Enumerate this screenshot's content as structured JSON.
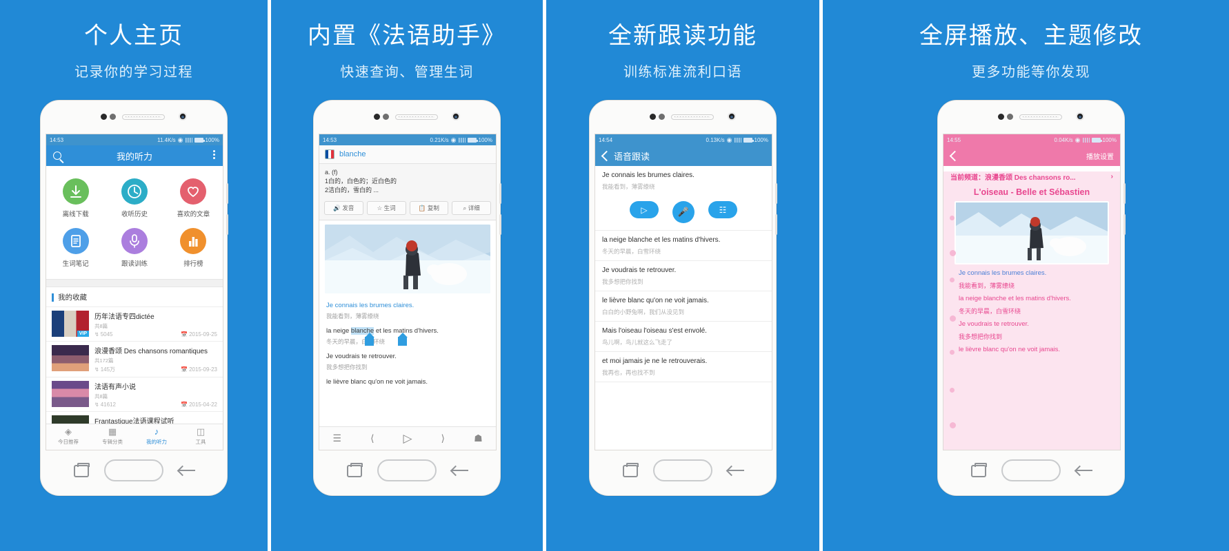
{
  "panels": [
    {
      "headline": "个人主页",
      "subhead": "记录你的学习过程",
      "status": {
        "time": "14:53",
        "net": "11.4K/s",
        "battery": "100%"
      },
      "appbar": {
        "title": "我的听力",
        "search_icon": "search-icon",
        "more_icon": "more-vertical-icon"
      },
      "grid": [
        {
          "label": "离线下载",
          "icon": "download-icon",
          "color": "#69bf5c"
        },
        {
          "label": "收听历史",
          "icon": "clock-icon",
          "color": "#2cadc7"
        },
        {
          "label": "喜欢的文章",
          "icon": "heart-icon",
          "color": "#e4606e"
        },
        {
          "label": "生词笔记",
          "icon": "notebook-icon",
          "color": "#4e9fe8"
        },
        {
          "label": "跟读训练",
          "icon": "microphone-icon",
          "color": "#ab7ede"
        },
        {
          "label": "排行榜",
          "icon": "bar-chart-icon",
          "color": "#f0902d"
        }
      ],
      "section_title": "我的收藏",
      "favorites": [
        {
          "title": "历年法语专四dictée",
          "count": "共8篇",
          "plays": "5045",
          "date": "2015-09-25",
          "badge": "VIP"
        },
        {
          "title": "浪漫香颂 Des chansons romantiques",
          "count": "共172篇",
          "plays": "145万",
          "date": "2015-09-23",
          "badge": ""
        },
        {
          "title": "法语有声小说",
          "count": "共8篇",
          "plays": "41612",
          "date": "2015-04-22",
          "badge": ""
        },
        {
          "title": "Frantastique法语课程试听",
          "count": "",
          "plays": "",
          "date": "",
          "badge": ""
        }
      ],
      "tabs": [
        {
          "label": "今日推荐",
          "icon": "compass-icon",
          "active": false
        },
        {
          "label": "专辑分类",
          "icon": "book-icon",
          "active": false
        },
        {
          "label": "我的听力",
          "icon": "headphones-icon",
          "active": true
        },
        {
          "label": "工具",
          "icon": "toolbox-icon",
          "active": false
        }
      ]
    },
    {
      "headline": "内置《法语助手》",
      "subhead": "快速查询、管理生词",
      "status": {
        "time": "14:53",
        "net": "0.21K/s",
        "battery": "100%"
      },
      "dict": {
        "word": "blanche",
        "flag_icon": "france-flag-icon",
        "definition_lines": [
          "a. (f)",
          "1白的，白色的；近白色的",
          "2洁白的，雪白的 ..."
        ],
        "buttons": [
          {
            "label": "发音",
            "icon": "speaker-icon"
          },
          {
            "label": "生词",
            "icon": "star-icon"
          },
          {
            "label": "复制",
            "icon": "copy-icon"
          },
          {
            "label": "详细",
            "icon": "magnifier-icon"
          }
        ]
      },
      "lyrics": [
        {
          "fr": "Je connais les brumes claires.",
          "cn": "我能看到，薄雾缭绕",
          "blue": true
        },
        {
          "fr": "la neige blanche et les matins d'hivers.",
          "cn": "冬天的早晨，白雪环绕",
          "blue": false,
          "highlight": "blanche"
        },
        {
          "fr": "Je voudrais te retrouver.",
          "cn": "我多想把你找到",
          "blue": false
        },
        {
          "fr": "le lièvre blanc qu'on ne voit jamais.",
          "cn": "",
          "blue": false
        }
      ],
      "player": [
        "equalizer-icon",
        "previous-icon",
        "play-icon",
        "next-icon",
        "graduation-icon"
      ]
    },
    {
      "headline": "全新跟读功能",
      "subhead": "训练标准流利口语",
      "status": {
        "time": "14:54",
        "net": "0.13K/s",
        "battery": "100%"
      },
      "appbar": {
        "title": "语音跟读",
        "back_icon": "chevron-left-icon"
      },
      "first": {
        "fr": "Je connais les brumes claires.",
        "cn": "我能看到，薄雾缭绕"
      },
      "controls": [
        {
          "icon": "play-icon",
          "shape": "pill"
        },
        {
          "icon": "microphone-icon",
          "shape": "circle"
        },
        {
          "icon": "waveform-icon",
          "shape": "pill"
        }
      ],
      "sentences": [
        {
          "fr": "la neige blanche et les matins d'hivers.",
          "cn": "冬天的早晨，白雪环绕"
        },
        {
          "fr": "Je voudrais te retrouver.",
          "cn": "我多想把你找到"
        },
        {
          "fr": "le lièvre blanc qu'on ne voit jamais.",
          "cn": "白白的小野兔啊，我们从没见到"
        },
        {
          "fr": "Mais l'oiseau l'oiseau s'est envolé.",
          "cn": "鸟儿啊，鸟儿就这么飞走了"
        },
        {
          "fr": "et moi jamais je ne le retrouverais.",
          "cn": "我再也，再也找不到"
        }
      ]
    },
    {
      "headline": "全屏播放、主题修改",
      "subhead": "更多功能等你发现",
      "status": {
        "time": "14:55",
        "net": "0.04K/s",
        "battery": "100%"
      },
      "appbar": {
        "title": "播放设置",
        "back_icon": "chevron-left-icon"
      },
      "channel": "当前频道：浪漫香颂 Des chansons ro...",
      "channel_arrow": "chevron-right-icon",
      "song_title": "L'oiseau - Belle et Sébastien",
      "lines": [
        {
          "text": "Je connais les brumes claires.",
          "type": "fr-blue"
        },
        {
          "text": "我能看到，薄雾缭绕",
          "type": "cn"
        },
        {
          "text": "la neige blanche et les matins d'hivers.",
          "type": "fr"
        },
        {
          "text": "冬天的早晨，白雪环绕",
          "type": "cn"
        },
        {
          "text": "Je voudrais te retrouver.",
          "type": "fr"
        },
        {
          "text": "我多想把你找到",
          "type": "cn"
        },
        {
          "text": "le lièvre blanc qu'on ne voit jamais.",
          "type": "fr"
        }
      ],
      "player": [
        "equalizer-icon",
        "previous-icon",
        "play-icon",
        "next-icon",
        "graduation-icon"
      ]
    }
  ],
  "theme": {
    "bg": "#2189d6",
    "accent": "#2f8fd8",
    "pink": "#f0639f",
    "pink_light": "#fce4ef"
  }
}
